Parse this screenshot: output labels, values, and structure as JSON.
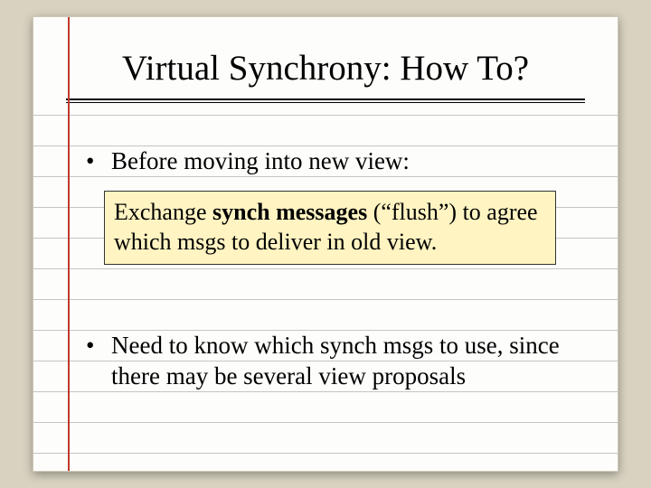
{
  "title": "Virtual Synchrony: How To?",
  "bullets": [
    "Before moving into new view:",
    "Need to know which synch msgs to use, since there may be several view proposals"
  ],
  "callout": {
    "prefix": "Exchange ",
    "bold": "synch messages",
    "suffix": " (“flush”) to agree which msgs to deliver in old view."
  }
}
